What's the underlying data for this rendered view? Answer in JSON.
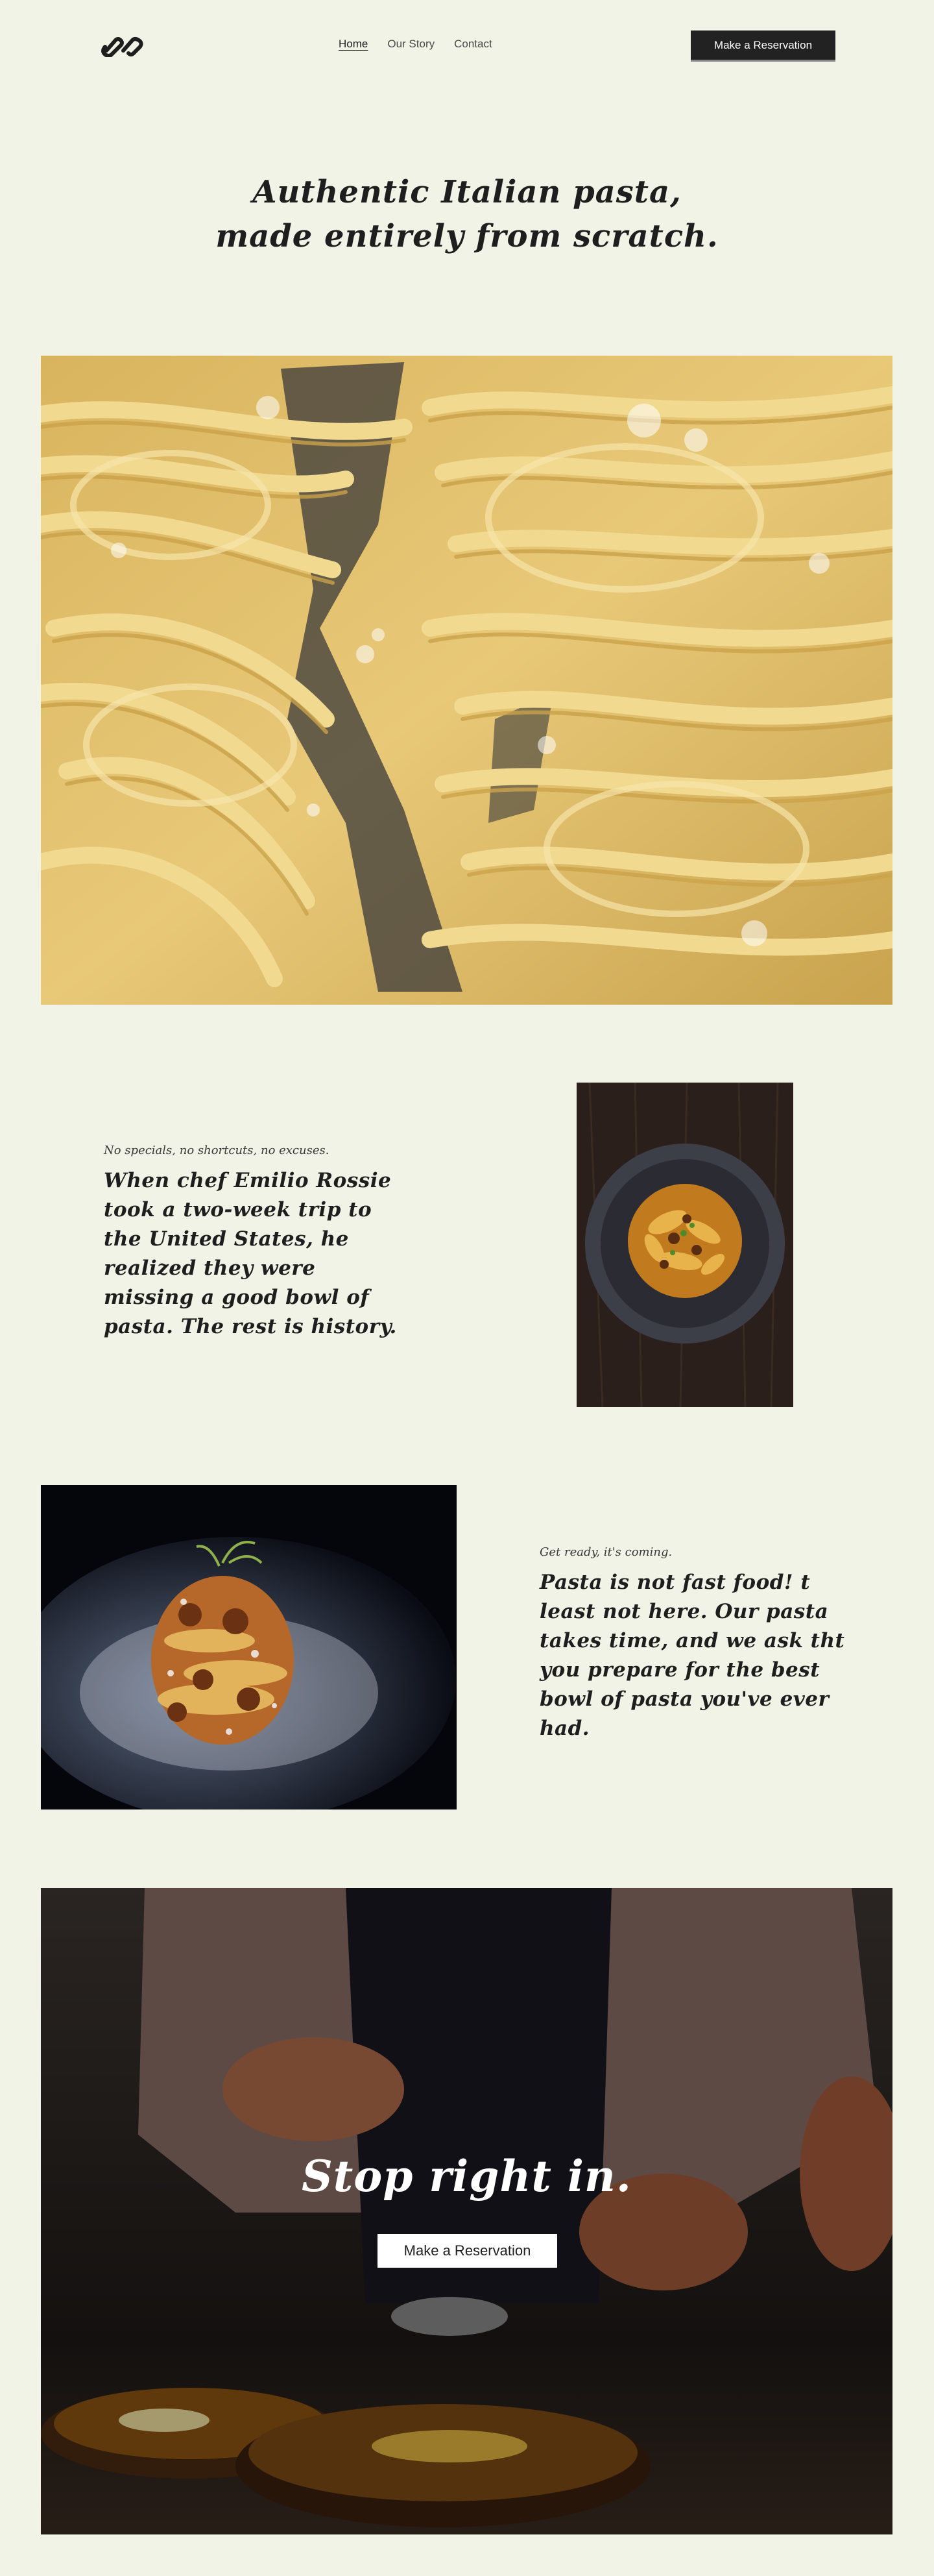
{
  "nav": {
    "links": [
      {
        "label": "Home"
      },
      {
        "label": "Our Story"
      },
      {
        "label": "Contact"
      }
    ],
    "reservation_label": "Make a Reservation"
  },
  "hero": {
    "title_line1": "Authentic Italian pasta,",
    "title_line2": "made entirely from scratch."
  },
  "story1": {
    "eyebrow": "No specials, no shortcuts, no excuses.",
    "body": "When chef Emilio Rossie took a two-week trip to the United States, he realized they were missing a good bowl of pasta. The rest is history."
  },
  "story2": {
    "eyebrow": "Get ready, it's coming.",
    "body": "Pasta is not fast food! t least not here. Our pasta takes time, and we ask tht you prepare for the best bowl of pasta you've ever had."
  },
  "cta": {
    "title": "Stop right in.",
    "button_label": "Make a Reservation"
  },
  "colors": {
    "background": "#f0f3e5",
    "text": "#1e1e1e",
    "button_dark": "#222222"
  }
}
